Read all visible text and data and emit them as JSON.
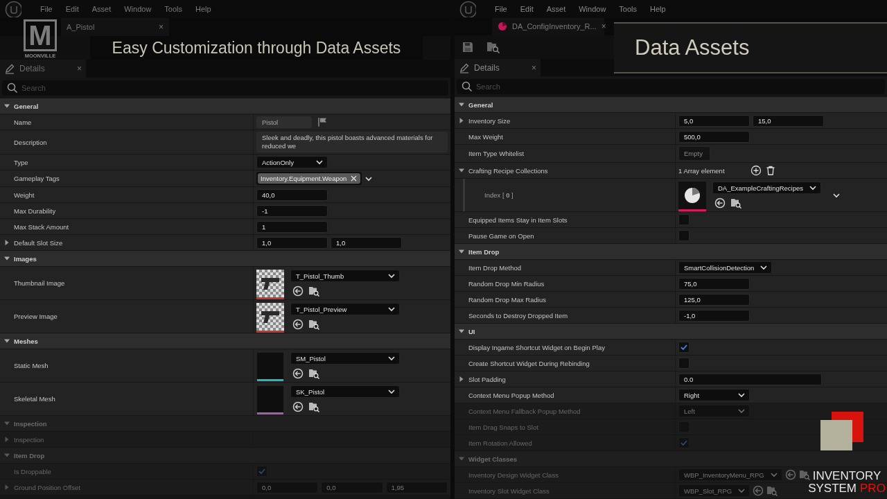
{
  "brand_logo": {
    "mark": "M",
    "name": "MOONVILLE"
  },
  "headline": "Easy Customization through Data Assets",
  "banner": "Data Assets",
  "product_logo": {
    "line1": "INVENTORY",
    "line2": "SYSTEM",
    "accent": "PRO"
  },
  "panels": [
    {
      "menu": [
        "File",
        "Edit",
        "Asset",
        "Window",
        "Tools",
        "Help"
      ],
      "doc_tab": {
        "label": "A_Pistol",
        "close": "×",
        "asset_icon": false
      },
      "toolbar": false,
      "details_tab": {
        "label": "Details",
        "close": "×"
      },
      "search": {
        "placeholder": "Search"
      },
      "sections": [
        {
          "title": "General",
          "expanded": true,
          "faded": false,
          "rows": [
            {
              "label": "Name",
              "kind": "name",
              "value": "Pistol",
              "expandable": false,
              "faded": false
            },
            {
              "label": "Description",
              "kind": "wide_text",
              "value": "Sleek and deadly, this pistol boasts advanced materials for reduced we",
              "expandable": false,
              "faded": false
            },
            {
              "label": "Type",
              "kind": "dropdown",
              "value": "ActionOnly",
              "expandable": false,
              "faded": false
            },
            {
              "label": "Gameplay Tags",
              "kind": "tags",
              "tags": [
                "Inventory.Equipment.Weapon"
              ],
              "expandable": false,
              "faded": false
            },
            {
              "label": "Weight",
              "kind": "text",
              "value": "40,0",
              "expandable": false,
              "faded": false
            },
            {
              "label": "Max Durability",
              "kind": "text",
              "value": "-1",
              "expandable": false,
              "faded": false
            },
            {
              "label": "Max Stack Amount",
              "kind": "text",
              "value": "1",
              "expandable": false,
              "faded": false
            },
            {
              "label": "Default Slot Size",
              "kind": "vector",
              "values": [
                "1,0",
                "1,0"
              ],
              "expandable": true,
              "expanded": false,
              "faded": false
            }
          ]
        },
        {
          "title": "Images",
          "expanded": true,
          "faded": false,
          "rows": [
            {
              "label": "Thumbnail Image",
              "kind": "texture_asset",
              "color": "#c0392b",
              "value": "T_Pistol_Thumb",
              "expandable": false,
              "faded": false
            },
            {
              "label": "Preview Image",
              "kind": "texture_asset",
              "color": "#c0392b",
              "value": "T_Pistol_Preview",
              "expandable": false,
              "faded": false
            }
          ]
        },
        {
          "title": "Meshes",
          "expanded": true,
          "faded": false,
          "rows": [
            {
              "label": "Static Mesh",
              "kind": "mesh_asset",
              "color": "#2bb5b5",
              "value": "SM_Pistol",
              "expandable": false,
              "faded": false
            },
            {
              "label": "Skeletal Mesh",
              "kind": "mesh_asset",
              "color": "#a05fa8",
              "value": "SK_Pistol",
              "expandable": false,
              "faded": false
            }
          ]
        },
        {
          "title": "Inspection",
          "expanded": true,
          "faded": true,
          "rows": [
            {
              "label": "Inspection",
              "kind": "none",
              "expandable": true,
              "expanded": false,
              "faded": true
            }
          ]
        },
        {
          "title": "Item Drop",
          "expanded": true,
          "faded": true,
          "rows": [
            {
              "label": "Is Droppable",
              "kind": "checkbox",
              "checked": true,
              "expandable": false,
              "faded": true
            },
            {
              "label": "Ground Position Offset",
              "kind": "vector",
              "values": [
                "0,0",
                "0,0",
                "1,95"
              ],
              "expandable": true,
              "expanded": false,
              "faded": true
            }
          ]
        }
      ]
    },
    {
      "menu": [
        "File",
        "Edit",
        "Asset",
        "Window",
        "Tools",
        "Help"
      ],
      "doc_tab": {
        "label": "DA_ConfigInventory_R...",
        "close": "×",
        "asset_icon": true
      },
      "toolbar": true,
      "details_tab": {
        "label": "Details",
        "close": "×"
      },
      "search": {
        "placeholder": "Search"
      },
      "sections": [
        {
          "title": "General",
          "expanded": true,
          "faded": false,
          "rows": [
            {
              "label": "Inventory Size",
              "kind": "vector",
              "values": [
                "5,0",
                "15,0"
              ],
              "expandable": true,
              "expanded": false,
              "faded": false
            },
            {
              "label": "Max Weight",
              "kind": "text",
              "value": "500,0",
              "expandable": false,
              "faded": false
            },
            {
              "label": "Item Type Whitelist",
              "kind": "empty_dropdown",
              "value": "Empty",
              "expandable": false,
              "faded": false
            },
            {
              "label": "Crafting Recipe Collections",
              "kind": "array",
              "value": "1 Array element",
              "expandable": true,
              "expanded": true,
              "faded": false,
              "children": [
                {
                  "label": "Index [ **0** ]",
                  "kind": "data_element",
                  "color": "#d81b60",
                  "value": "DA_ExampleCraftingRecipes",
                  "expandable": false,
                  "faded": false
                }
              ]
            },
            {
              "label": "Equipped Items Stay in Item Slots",
              "kind": "checkbox",
              "checked": false,
              "expandable": false,
              "faded": false
            },
            {
              "label": "Pause Game on Open",
              "kind": "checkbox",
              "checked": false,
              "expandable": false,
              "faded": false
            }
          ]
        },
        {
          "title": "Item Drop",
          "expanded": true,
          "faded": false,
          "rows": [
            {
              "label": "Item Drop Method",
              "kind": "dropdown",
              "value": "SmartCollisionDetection",
              "expandable": false,
              "faded": false
            },
            {
              "label": "Random Drop Min Radius",
              "kind": "text",
              "value": "75,0",
              "expandable": false,
              "faded": false
            },
            {
              "label": "Random Drop Max Radius",
              "kind": "text",
              "value": "125,0",
              "expandable": false,
              "faded": false
            },
            {
              "label": "Seconds to Destroy Dropped Item",
              "kind": "text",
              "value": "-1,0",
              "expandable": false,
              "faded": false
            }
          ]
        },
        {
          "title": "UI",
          "expanded": true,
          "faded": false,
          "rows": [
            {
              "label": "Display Ingame Shortcut Widget on Begin Play",
              "kind": "checkbox",
              "checked": true,
              "expandable": false,
              "faded": false
            },
            {
              "label": "Create Shortcut Widget During Rebinding",
              "kind": "checkbox",
              "checked": false,
              "expandable": false,
              "faded": false
            },
            {
              "label": "Slot Padding",
              "kind": "text_wide",
              "value": "0.0",
              "expandable": true,
              "expanded": false,
              "faded": false
            },
            {
              "label": "Context Menu Popup Method",
              "kind": "dropdown",
              "value": "Right",
              "expandable": false,
              "faded": false
            },
            {
              "label": "Context Menu Fallback Popup Method",
              "kind": "dropdown",
              "value": "Left",
              "expandable": false,
              "faded": true
            },
            {
              "label": "Item Drag Snaps to Slot",
              "kind": "checkbox",
              "checked": false,
              "expandable": false,
              "faded": true
            },
            {
              "label": "Item Rotation Allowed",
              "kind": "checkbox",
              "checked": true,
              "expandable": false,
              "faded": true
            }
          ]
        },
        {
          "title": "Widget Classes",
          "expanded": true,
          "faded": true,
          "rows": [
            {
              "label": "Inventory Design Widget Class",
              "kind": "class",
              "value": "WBP_InventoryMenu_RPG",
              "expandable": false,
              "faded": true
            },
            {
              "label": "Inventory Slot Widget Class",
              "kind": "class",
              "value": "WBP_Slot_RPG",
              "expandable": false,
              "faded": true
            }
          ]
        }
      ]
    }
  ]
}
